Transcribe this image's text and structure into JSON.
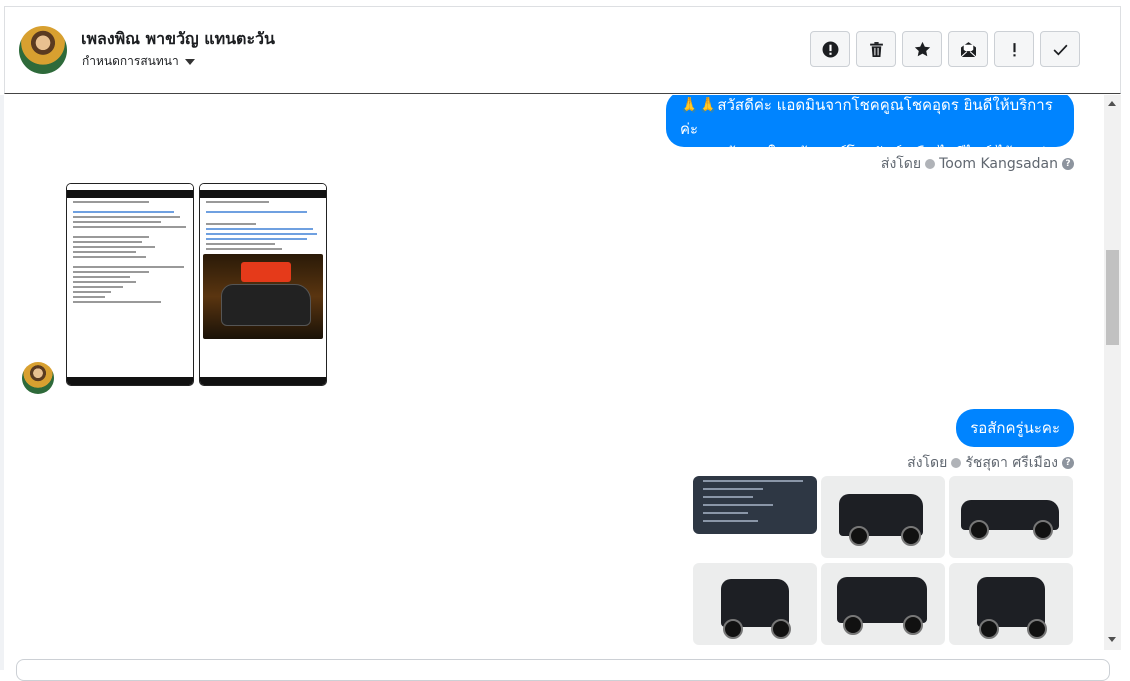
{
  "header": {
    "contact_name": "เพลงพิณ พาขวัญ แทนตะวัน",
    "assign_label": "กำหนดการสนทนา",
    "actions": [
      {
        "name": "spam-button",
        "icon": "exclamation-circle-icon"
      },
      {
        "name": "delete-button",
        "icon": "trash-icon"
      },
      {
        "name": "star-button",
        "icon": "star-icon"
      },
      {
        "name": "mark-unread-button",
        "icon": "envelope-open-icon"
      },
      {
        "name": "important-button",
        "icon": "exclamation-icon"
      },
      {
        "name": "done-button",
        "icon": "check-icon"
      }
    ]
  },
  "messages": {
    "outgoing_1": {
      "line1": "🙏🙏สวัสดีค่ะ แอดมินจากโชคคูณโชคอุดร ยินดีให้บริการค่ะ",
      "line2": "หากลูกค้า สนใจ แจ้งเบอร์โทรศัพท์ หรือ ไอดีไลน์  ไว้เลยค่ะ",
      "sent_by_label": "ส่งโดย",
      "sender": "Toom Kangsadan"
    },
    "incoming_screenshots": {
      "count": 2,
      "items": [
        "listing-screenshot",
        "promo-screenshot"
      ]
    },
    "outgoing_2": {
      "text": "รอสักครู่นะคะ",
      "sent_by_label": "ส่งโดย",
      "sender": "รัชสุดา ศรีเมือง"
    },
    "outgoing_photos": {
      "count": 6,
      "items": [
        "spec-sheet",
        "truck-rear-three-quarter",
        "truck-side",
        "truck-rear",
        "truck-front-three-quarter",
        "truck-front"
      ]
    }
  },
  "colors": {
    "bubble": "#0084ff",
    "meta_text": "#606770",
    "border": "#ccd0d5"
  }
}
